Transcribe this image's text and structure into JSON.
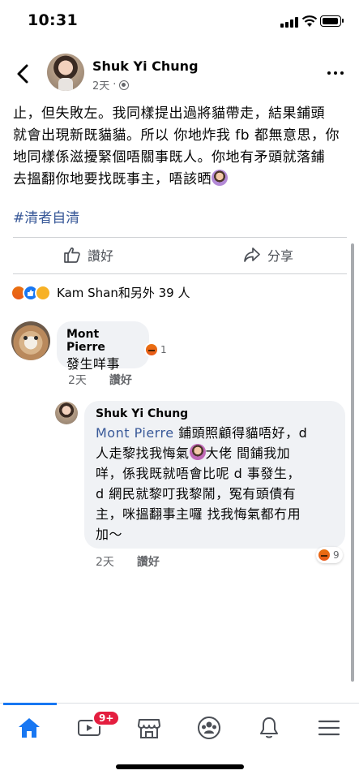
{
  "status_bar": {
    "time": "10:31"
  },
  "header": {
    "name": "Shuk Yi Chung",
    "time_ago": "2天"
  },
  "post": {
    "lines": [
      "止，但失敗左。我同樣提出過將貓帶走，結果鋪頭",
      "就會出現新既貓貓。所以 你地炸我 fb 都無意思，你",
      "地同樣係滋擾緊個唔關事既人。你地有矛頭就落鋪",
      "去搵翻你地要找既事主，唔該晒"
    ],
    "hashtag": "#清者自清"
  },
  "actions": {
    "like_label": "讚好",
    "share_label": "分享"
  },
  "reactions": {
    "summary": "Kam Shan和另外 39 人"
  },
  "comments": [
    {
      "name": "Mont Pierre",
      "text": "發生咩事",
      "time_ago": "2天",
      "like_label": "讚好",
      "reaction_count": "1"
    },
    {
      "name": "Shuk Yi Chung",
      "mention": "Mont Pierre",
      "lines": [
        " 鋪頭照顧得貓唔好，d",
        "人走黎找我悔氣",
        "大佬 間鋪我加",
        "咩，係我既就唔會比呢 d 事發生，",
        "d 網民就黎叮我黎鬧，冤有頭債有",
        "主，咪搵翻事主囉 找我悔氣都冇用",
        "加～"
      ],
      "time_ago": "2天",
      "like_label": "讚好",
      "reaction_count": "9"
    }
  ],
  "tabbar": {
    "tabs": [
      "home-icon",
      "watch-icon",
      "marketplace-icon",
      "groups-icon",
      "notifications-icon",
      "menu-icon"
    ],
    "watch_badge": "9+"
  },
  "colors": {
    "brand": "#1877f2",
    "link": "#385898",
    "badge": "#e41e3f"
  }
}
